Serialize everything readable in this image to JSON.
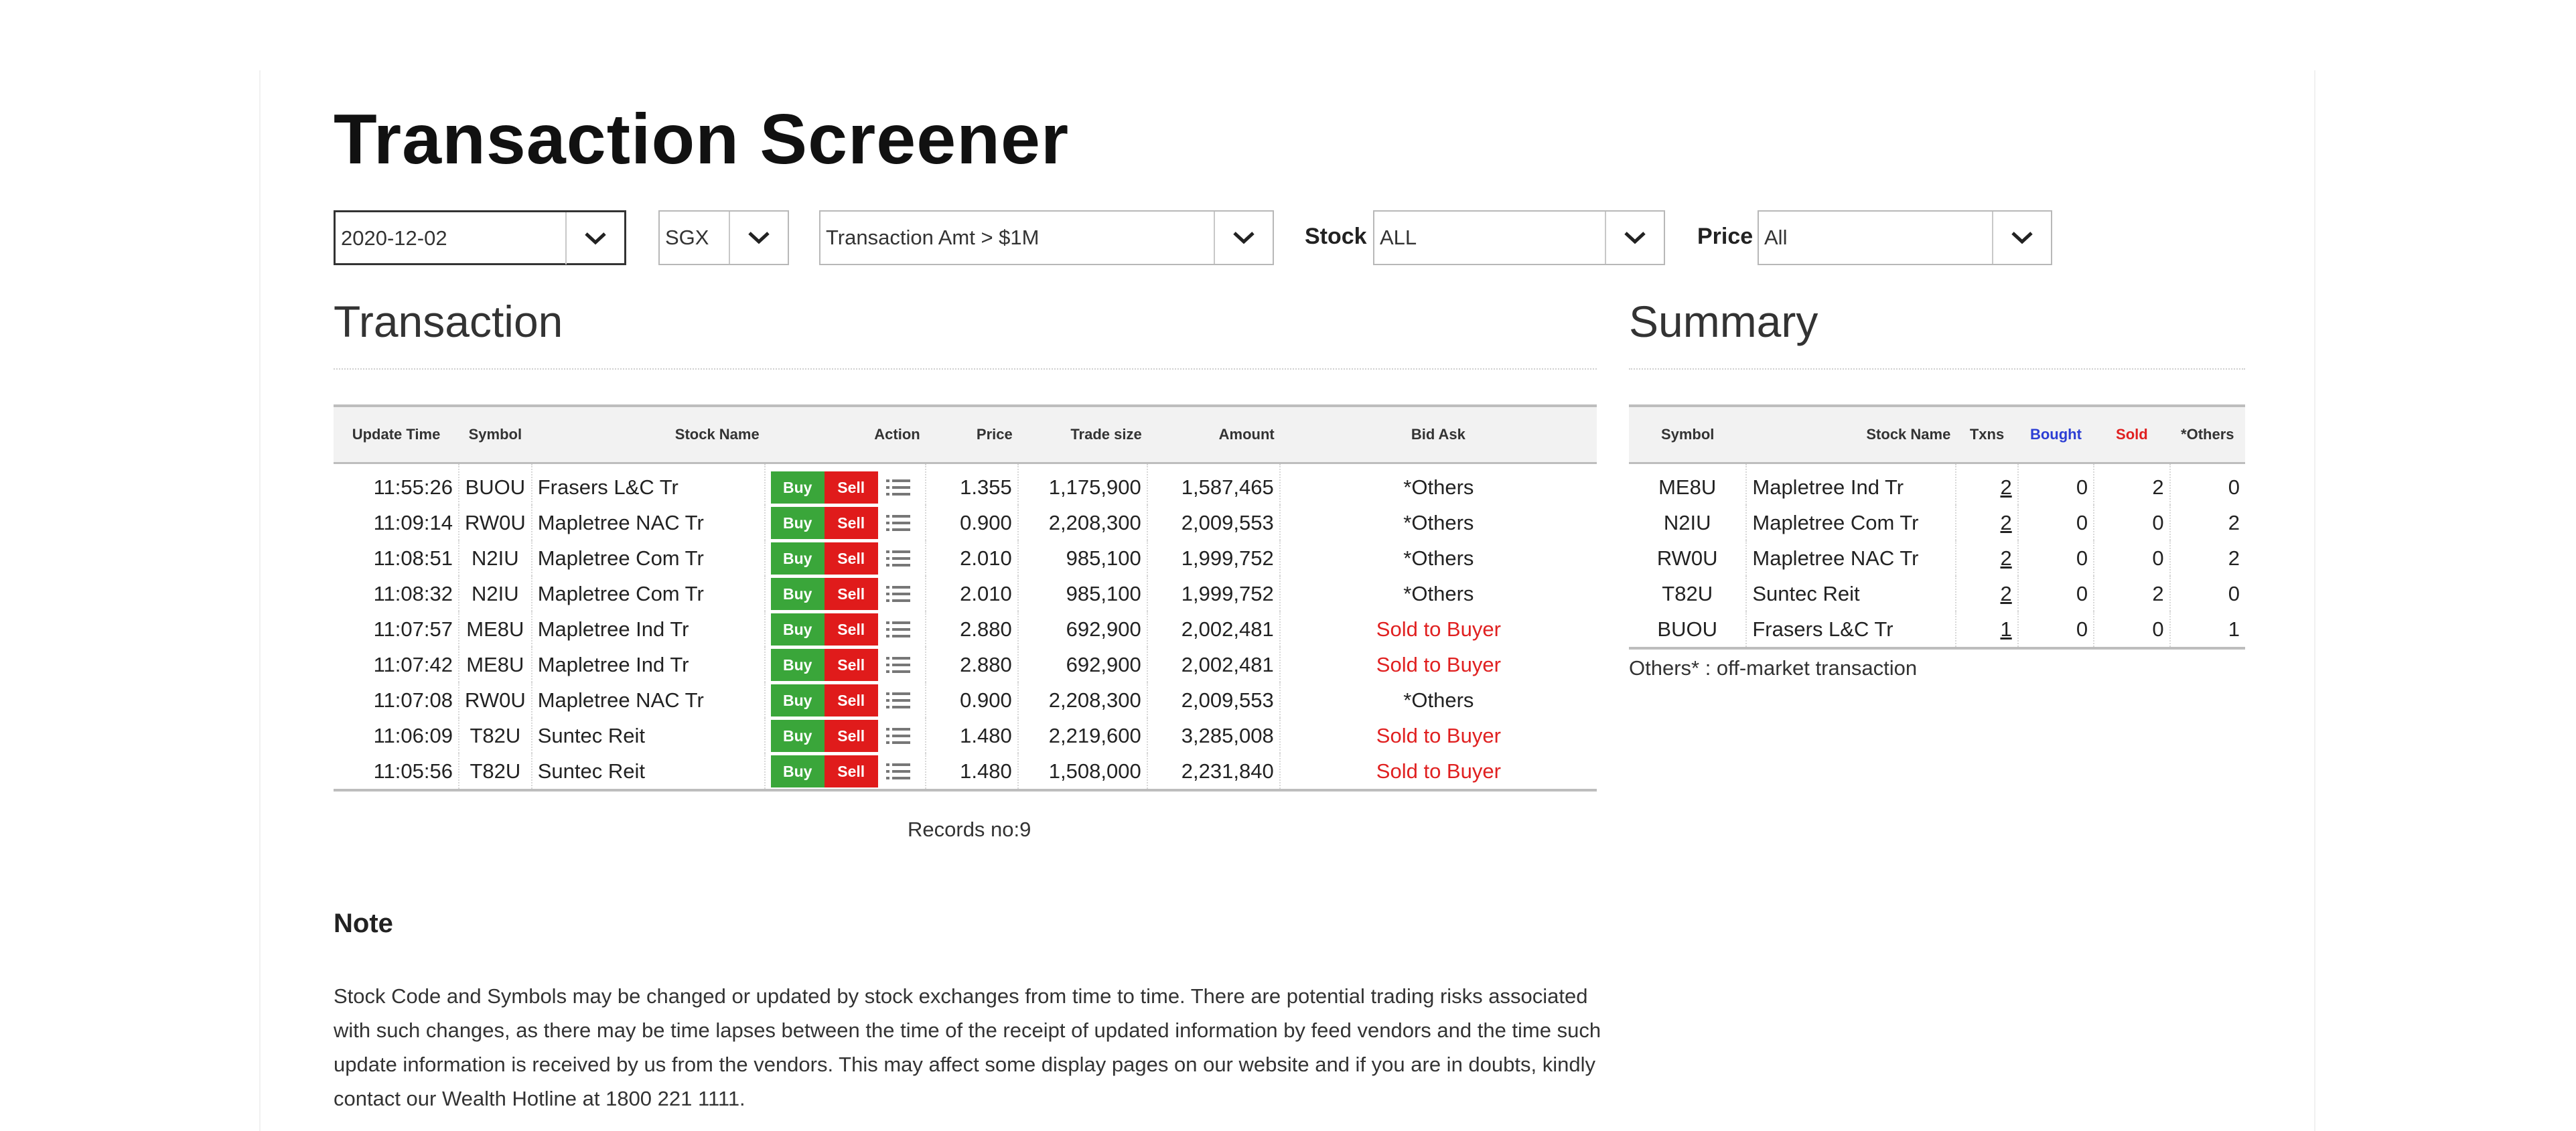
{
  "page": {
    "title": "Transaction Screener"
  },
  "filters": {
    "date": "2020-12-02",
    "exchange": "SGX",
    "criteria": "Transaction Amt > $1M",
    "stock_label": "Stock",
    "stock_value": "ALL",
    "price_label": "Price",
    "price_value": "All"
  },
  "transaction": {
    "title": "Transaction",
    "columns": [
      "Update Time",
      "Symbol",
      "Stock Name",
      "Action",
      "Price",
      "Trade size",
      "Amount",
      "Bid Ask"
    ],
    "buy_label": "Buy",
    "sell_label": "Sell",
    "rows": [
      {
        "time": "11:55:26",
        "symbol": "BUOU",
        "name": "Frasers L&C Tr",
        "price": "1.355",
        "size": "1,175,900",
        "amount": "1,587,465",
        "bidask": "*Others"
      },
      {
        "time": "11:09:14",
        "symbol": "RW0U",
        "name": "Mapletree NAC Tr",
        "price": "0.900",
        "size": "2,208,300",
        "amount": "2,009,553",
        "bidask": "*Others"
      },
      {
        "time": "11:08:51",
        "symbol": "N2IU",
        "name": "Mapletree Com Tr",
        "price": "2.010",
        "size": "985,100",
        "amount": "1,999,752",
        "bidask": "*Others"
      },
      {
        "time": "11:08:32",
        "symbol": "N2IU",
        "name": "Mapletree Com Tr",
        "price": "2.010",
        "size": "985,100",
        "amount": "1,999,752",
        "bidask": "*Others"
      },
      {
        "time": "11:07:57",
        "symbol": "ME8U",
        "name": "Mapletree Ind Tr",
        "price": "2.880",
        "size": "692,900",
        "amount": "2,002,481",
        "bidask": "Sold to Buyer"
      },
      {
        "time": "11:07:42",
        "symbol": "ME8U",
        "name": "Mapletree Ind Tr",
        "price": "2.880",
        "size": "692,900",
        "amount": "2,002,481",
        "bidask": "Sold to Buyer"
      },
      {
        "time": "11:07:08",
        "symbol": "RW0U",
        "name": "Mapletree NAC Tr",
        "price": "0.900",
        "size": "2,208,300",
        "amount": "2,009,553",
        "bidask": "*Others"
      },
      {
        "time": "11:06:09",
        "symbol": "T82U",
        "name": "Suntec Reit",
        "price": "1.480",
        "size": "2,219,600",
        "amount": "3,285,008",
        "bidask": "Sold to Buyer"
      },
      {
        "time": "11:05:56",
        "symbol": "T82U",
        "name": "Suntec Reit",
        "price": "1.480",
        "size": "1,508,000",
        "amount": "2,231,840",
        "bidask": "Sold to Buyer"
      }
    ],
    "records": "Records no:9"
  },
  "summary": {
    "title": "Summary",
    "columns": [
      "Symbol",
      "Stock Name",
      "Txns",
      "Bought",
      "Sold",
      "*Others"
    ],
    "rows": [
      {
        "symbol": "ME8U",
        "name": "Mapletree Ind Tr",
        "txns": "2",
        "bought": "0",
        "sold": "2",
        "others": "0"
      },
      {
        "symbol": "N2IU",
        "name": "Mapletree Com Tr",
        "txns": "2",
        "bought": "0",
        "sold": "0",
        "others": "2"
      },
      {
        "symbol": "RW0U",
        "name": "Mapletree NAC Tr",
        "txns": "2",
        "bought": "0",
        "sold": "0",
        "others": "2"
      },
      {
        "symbol": "T82U",
        "name": "Suntec Reit",
        "txns": "2",
        "bought": "0",
        "sold": "2",
        "others": "0"
      },
      {
        "symbol": "BUOU",
        "name": "Frasers L&C Tr",
        "txns": "1",
        "bought": "0",
        "sold": "0",
        "others": "1"
      }
    ],
    "footnote": "Others* : off-market transaction"
  },
  "note": {
    "title": "Note",
    "body": "Stock Code and Symbols may be changed or updated by stock exchanges from time to time. There are potential trading risks associated with such changes, as there may be time lapses between the time of the receipt of updated information by feed vendors and the time such update information is received by us from the vendors. This may affect some display pages on our website and if you are in doubts, kindly contact our Wealth Hotline at 1800 221 1111."
  },
  "colors": {
    "buy": "#3aa63a",
    "sell": "#e01b1b",
    "sold_text": "#e02020",
    "bought_header": "#2c3ed4"
  },
  "icons": {
    "dropdown": "chevron-down-icon",
    "action_list": "list-icon"
  }
}
